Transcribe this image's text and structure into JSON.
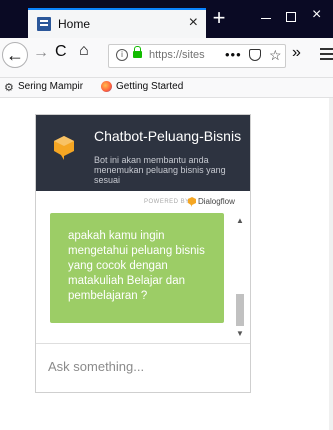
{
  "browser": {
    "tab": {
      "title": "Home",
      "close": "×"
    },
    "new_tab": "+",
    "window": {
      "close": "×"
    },
    "nav": {
      "back": "←",
      "forward": "→",
      "reload": "C",
      "home": "⌂"
    },
    "url": {
      "info": "i",
      "text": "https://sites",
      "more": "•••",
      "bookmark": "☆"
    },
    "overflow": "»",
    "bookmarks": [
      {
        "label": "Sering Mampir",
        "icon": "gear-icon"
      },
      {
        "label": "Getting Started",
        "icon": "firefox-icon"
      }
    ]
  },
  "chatbot": {
    "name": "Chatbot-Peluang-Bisnis",
    "description": "Bot ini akan membantu anda menemukan peluang bisnis yang sesuai",
    "powered_by": "POWERED BY",
    "provider": "Dialogflow",
    "messages": [
      {
        "from": "bot",
        "text": "apakah kamu ingin mengetahui peluang bisnis yang cocok dengan matakuliah Belajar dan pembelajaran ?"
      }
    ],
    "scroll_up": "▲",
    "scroll_down": "▼",
    "input_placeholder": "Ask something..."
  },
  "colors": {
    "header_bg": "#2d3340",
    "bubble_bg": "#9ccd66",
    "avatar": "#f5a623",
    "titlebar_bg": "#0a0a24",
    "tab_accent": "#0a84ff"
  }
}
